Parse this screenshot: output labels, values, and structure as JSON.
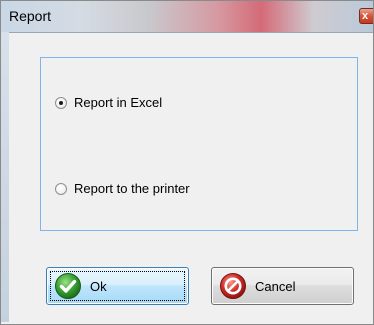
{
  "window": {
    "title": "Report",
    "close_glyph": "x"
  },
  "options": [
    {
      "label": "Report in Excel",
      "selected": true
    },
    {
      "label": "Report to the printer",
      "selected": false
    }
  ],
  "buttons": {
    "ok_label": "Ok",
    "cancel_label": "Cancel"
  },
  "icons": {
    "ok": "green-checkmark-icon",
    "cancel": "red-no-entry-icon",
    "close": "close-icon"
  },
  "colors": {
    "group_border": "#7eb4ea",
    "ok_border": "#3c7fb1",
    "check_green": "#3aa534",
    "cancel_red": "#d2302c"
  }
}
